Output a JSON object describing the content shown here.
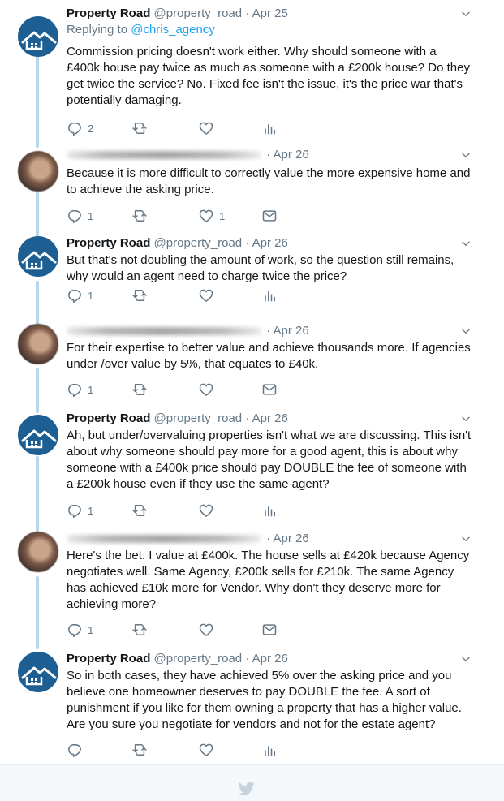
{
  "tweets": [
    {
      "author_type": "brand",
      "name": "Property Road",
      "handle": "@property_road",
      "sep": "·",
      "date": "Apr 25",
      "replying_prefix": "Replying to ",
      "replying_to": "@chris_agency",
      "text": "Commission pricing doesn't work either. Why should someone with a £400k house pay twice as much as someone with a £200k house? Do they get twice the service? No. Fixed fee isn't the issue, it's the price war that's potentially damaging.",
      "reply_count": "2",
      "like_count": "",
      "last_icon": "analytics-icon"
    },
    {
      "author_type": "person",
      "name": "",
      "sep": "·",
      "date": "Apr 26",
      "text": "Because it is more difficult to correctly value the more expensive home and to achieve the asking price.",
      "reply_count": "1",
      "like_count": "1",
      "last_icon": "mail-icon"
    },
    {
      "author_type": "brand",
      "name": "Property Road",
      "handle": "@property_road",
      "sep": "·",
      "date": "Apr 26",
      "text": "But that's not doubling the amount of work, so the question still remains, why would an agent need to charge twice the price?",
      "reply_count": "1",
      "like_count": "",
      "last_icon": "analytics-icon"
    },
    {
      "author_type": "person",
      "name": "",
      "sep": "·",
      "date": "Apr 26",
      "text": "For their expertise to better value and achieve thousands more. If agencies under /over value by 5%, that equates to £40k.",
      "reply_count": "1",
      "like_count": "",
      "last_icon": "mail-icon"
    },
    {
      "author_type": "brand",
      "name": "Property Road",
      "handle": "@property_road",
      "sep": "·",
      "date": "Apr 26",
      "text": "Ah, but under/overvaluing properties isn't what we are discussing. This isn't about why someone should pay more for a good agent, this is about why someone with a £400k price should pay DOUBLE the fee of someone with a £200k house even if they use the same agent?",
      "reply_count": "1",
      "like_count": "",
      "last_icon": "analytics-icon"
    },
    {
      "author_type": "person",
      "name": "",
      "sep": "·",
      "date": "Apr 26",
      "text": "Here's the bet. I value at £400k. The house sells at £420k because Agency negotiates well. Same Agency, £200k sells for £210k. The same Agency has achieved £10k more for Vendor. Why don't they deserve more for achieving more?",
      "reply_count": "1",
      "like_count": "",
      "last_icon": "mail-icon"
    },
    {
      "author_type": "brand",
      "name": "Property Road",
      "handle": "@property_road",
      "sep": "·",
      "date": "Apr 26",
      "text": "So in both cases, they have achieved 5% over the asking price and you believe one homeowner deserves to pay DOUBLE the fee. A sort of punishment if you like for them owning a property that has a higher value. Are you sure you negotiate for vendors and not for the estate agent?",
      "reply_count": "",
      "like_count": "",
      "last_icon": "analytics-icon"
    }
  ],
  "colors": {
    "thread_line": "#b7d7ec",
    "brand_avatar": "#1e5f93",
    "link": "#1da1f2",
    "muted": "#657786"
  },
  "footer": {
    "icon": "twitter-bird-icon"
  }
}
